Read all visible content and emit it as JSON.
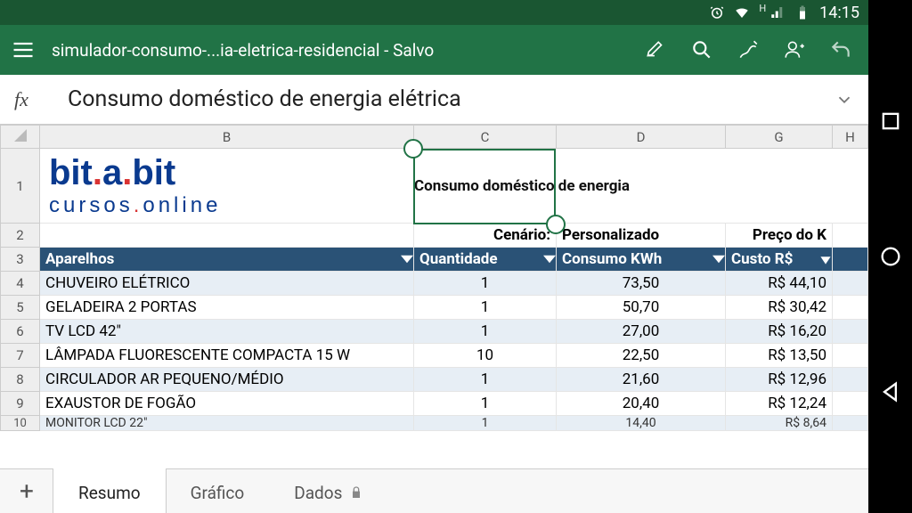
{
  "status": {
    "time": "14:15",
    "h": "H"
  },
  "appbar": {
    "title": "simulador-consumo-...ia-eletrica-residencial - Salvo"
  },
  "fx": {
    "label": "fx",
    "content": "Consumo doméstico de energia elétrica"
  },
  "columns": {
    "B": "B",
    "C": "C",
    "D": "D",
    "G": "G",
    "H": "H"
  },
  "rows": [
    "1",
    "2",
    "3",
    "4",
    "5",
    "6",
    "7",
    "8",
    "9",
    "10"
  ],
  "logo": {
    "a": "bit",
    "b": "a",
    "c": "bit",
    "sub1": "cursos",
    "sub2": "online"
  },
  "titlecell": "Consumo doméstico de energia ",
  "row2": {
    "c": "Cenário:",
    "d": "Personalizado",
    "g": "Preço do K"
  },
  "headers": {
    "b": "Aparelhos",
    "c": "Quantidade",
    "d": "Consumo KWh",
    "g": "Custo R$"
  },
  "data": [
    {
      "b": "CHUVEIRO ELÉTRICO",
      "c": "1",
      "d": "73,50",
      "g": "R$   44,10"
    },
    {
      "b": "GELADEIRA 2 PORTAS",
      "c": "1",
      "d": "50,70",
      "g": "R$   30,42"
    },
    {
      "b": "TV LCD 42\"",
      "c": "1",
      "d": "27,00",
      "g": "R$   16,20"
    },
    {
      "b": "LÂMPADA FLUORESCENTE COMPACTA 15 W",
      "c": "10",
      "d": "22,50",
      "g": "R$   13,50"
    },
    {
      "b": "CIRCULADOR AR PEQUENO/MÉDIO",
      "c": "1",
      "d": "21,60",
      "g": "R$   12,96"
    },
    {
      "b": "EXAUSTOR DE FOGÃO",
      "c": "1",
      "d": "20,40",
      "g": "R$   12,24"
    },
    {
      "b": "MONITOR LCD 22\"",
      "c": "1",
      "d": "14,40",
      "g": "R$     8,64"
    }
  ],
  "tabs": {
    "t1": "Resumo",
    "t2": "Gráfico",
    "t3": "Dados"
  },
  "colors": {
    "excel": "#217346",
    "hdr": "#2a5276",
    "band": "#e7eef5"
  }
}
